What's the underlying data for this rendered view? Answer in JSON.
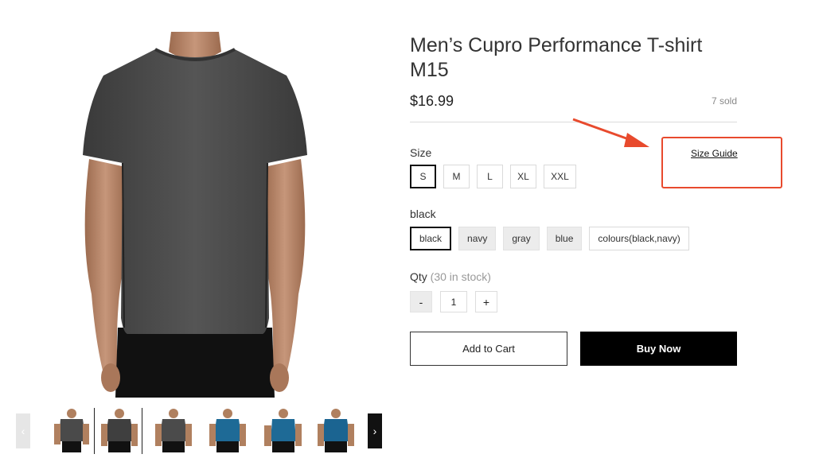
{
  "product": {
    "title": "Men’s Cupro Performance T-shirt M15",
    "price": "$16.99",
    "sold": "7 sold"
  },
  "size": {
    "label": "Size",
    "options": [
      "S",
      "M",
      "L",
      "XL",
      "XXL"
    ],
    "selected": "S",
    "guide_label": "Size Guide"
  },
  "color": {
    "label": "black",
    "options": [
      "black",
      "navy",
      "gray",
      "blue",
      "colours(black,navy)"
    ],
    "selected": "black"
  },
  "quantity": {
    "label": "Qty",
    "stock": "(30 in stock)",
    "minus": "-",
    "value": "1",
    "plus": "+"
  },
  "actions": {
    "add_to_cart": "Add to Cart",
    "buy_now": "Buy Now"
  },
  "gallery": {
    "prev_icon": "chevron-left-icon",
    "next_icon": "chevron-right-icon",
    "prev_glyph": "‹",
    "next_glyph": "›",
    "thumbnail_colors": [
      "#4a4a4a",
      "#3f3f3f",
      "#4b4b4b",
      "#1e6a96",
      "#1e6a96",
      "#1b6491"
    ]
  },
  "colors": {
    "annotation_red": "#e84a2d",
    "shirt": "#4a4a4a",
    "skin": "#c08d6e"
  }
}
